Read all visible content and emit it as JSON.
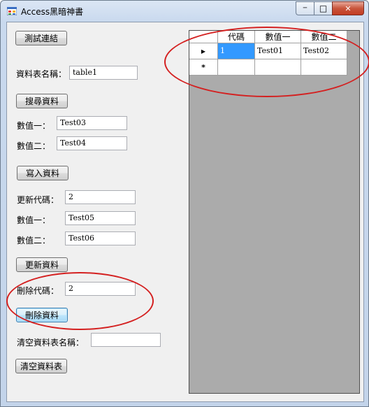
{
  "window": {
    "title": "Access黑暗神書",
    "minimize_glyph": "─",
    "maximize_glyph": "□",
    "close_glyph": "✕"
  },
  "form": {
    "test_connection_button": "測試連結",
    "table_name_label": "資料表名稱：",
    "table_name_value": "table1",
    "search_button": "搜尋資料",
    "insert": {
      "value1_label": "數值一：",
      "value1": "Test03",
      "value2_label": "數值二：",
      "value2": "Test04",
      "button": "寫入資料"
    },
    "update": {
      "id_label": "更新代碼：",
      "id_value": "2",
      "value1_label": "數值一：",
      "value1": "Test05",
      "value2_label": "數值二：",
      "value2": "Test06",
      "button": "更新資料"
    },
    "delete": {
      "id_label": "刪除代碼：",
      "id_value": "2",
      "button": "刪除資料"
    },
    "clear": {
      "table_label": "清空資料表名稱：",
      "table_value": "",
      "button": "清空資料表"
    }
  },
  "grid": {
    "columns": [
      "代碼",
      "數值一",
      "數值二"
    ],
    "rows": [
      {
        "marker": "▶",
        "cells": [
          "1",
          "Test01",
          "Test02"
        ]
      },
      {
        "marker": "*",
        "cells": [
          "",
          "",
          ""
        ]
      }
    ]
  },
  "annotation_color": "#d42020"
}
